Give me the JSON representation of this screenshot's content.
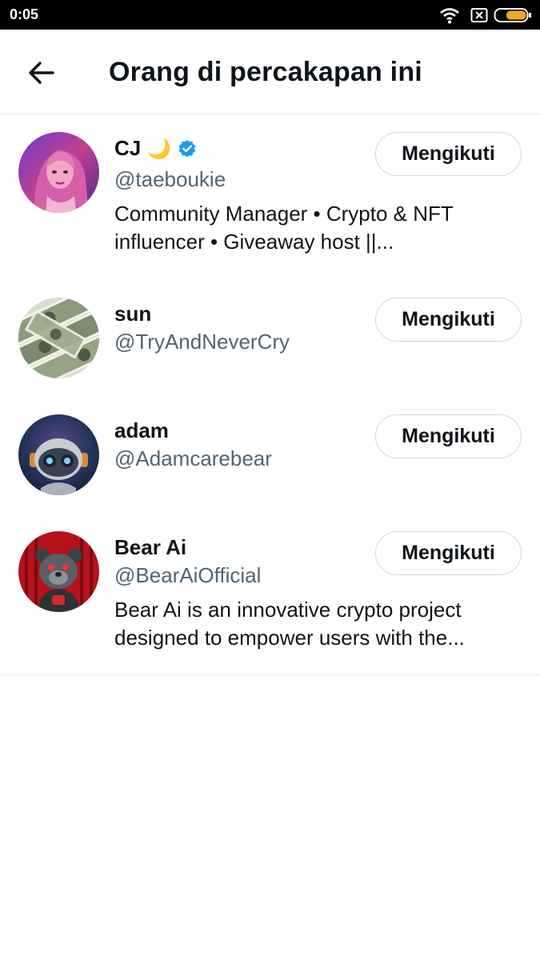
{
  "status_bar": {
    "time": "0:05"
  },
  "header": {
    "title": "Orang di percakapan ini"
  },
  "colors": {
    "verified_badge": "#1d9bf0",
    "handle_text": "#536471",
    "primary_text": "#0f1419",
    "divider": "#e6e9ec"
  },
  "users": [
    {
      "name": "CJ",
      "emoji": "🌙",
      "verified": true,
      "handle": "@taeboukie",
      "bio_line1": "Community Manager • Crypto & NFT",
      "bio_line2": "influencer • Giveaway host ||...",
      "button_label": "Mengikuti"
    },
    {
      "name": "sun",
      "handle": "@TryAndNeverCry",
      "button_label": "Mengikuti"
    },
    {
      "name": "adam",
      "handle": "@Adamcarebear",
      "button_label": "Mengikuti"
    },
    {
      "name": "Bear Ai",
      "handle": "@BearAiOfficial",
      "bio_line1": "Bear Ai is an innovative crypto project",
      "bio_line2": "designed to empower users with the...",
      "button_label": "Mengikuti"
    }
  ]
}
